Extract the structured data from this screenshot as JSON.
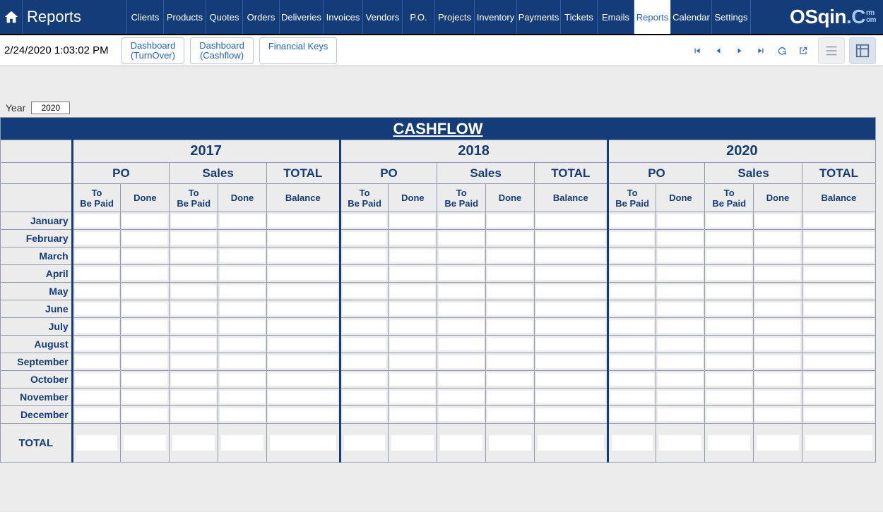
{
  "header": {
    "title": "Reports",
    "tabs": [
      "Clients",
      "Products",
      "Quotes",
      "Orders",
      "Deliveries",
      "Invoices",
      "Vendors",
      "P.O.",
      "Projects",
      "Inventory",
      "Payments",
      "Tickets",
      "Emails",
      "Reports",
      "Calendar",
      "Settings"
    ],
    "active_tab_index": 13,
    "brand_main": "OSqin",
    "brand_dot": ".C",
    "brand_suffix_top": "rm",
    "brand_suffix_bottom": "om"
  },
  "subbar": {
    "timestamp": "2/24/2020 1:03:02 PM",
    "buttons": [
      {
        "line1": "Dashboard",
        "line2": "(TurnOver)"
      },
      {
        "line1": "Dashboard",
        "line2": "(Cashflow)"
      },
      {
        "line1": "Financial Keys",
        "line2": ""
      }
    ]
  },
  "filter": {
    "year_label": "Year",
    "year_value": "2020"
  },
  "report": {
    "title": "CASHFLOW",
    "years": [
      "2017",
      "2018",
      "2020"
    ],
    "groups": [
      "PO",
      "Sales",
      "TOTAL"
    ],
    "sub_tobe": "To Be Paid",
    "sub_done": "Done",
    "sub_balance": "Balance",
    "months": [
      "January",
      "February",
      "March",
      "April",
      "May",
      "June",
      "July",
      "August",
      "September",
      "October",
      "November",
      "December"
    ],
    "total_label": "TOTAL"
  },
  "chart_data": {
    "type": "table",
    "title": "CASHFLOW",
    "row_labels": [
      "January",
      "February",
      "March",
      "April",
      "May",
      "June",
      "July",
      "August",
      "September",
      "October",
      "November",
      "December",
      "TOTAL"
    ],
    "column_groups": [
      {
        "year": "2017",
        "columns": [
          "PO To Be Paid",
          "PO Done",
          "Sales To Be Paid",
          "Sales Done",
          "TOTAL Balance"
        ]
      },
      {
        "year": "2018",
        "columns": [
          "PO To Be Paid",
          "PO Done",
          "Sales To Be Paid",
          "Sales Done",
          "TOTAL Balance"
        ]
      },
      {
        "year": "2020",
        "columns": [
          "PO To Be Paid",
          "PO Done",
          "Sales To Be Paid",
          "Sales Done",
          "TOTAL Balance"
        ]
      }
    ],
    "note": "All data cells are blank in the screenshot."
  }
}
